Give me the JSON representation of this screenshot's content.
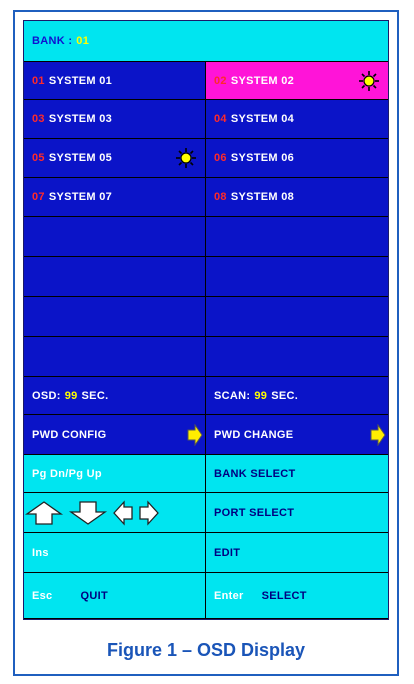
{
  "bank": {
    "label": "BANK :",
    "value": "01"
  },
  "systems": [
    {
      "num": "01",
      "name": "SYSTEM 01",
      "selected": false,
      "active": false
    },
    {
      "num": "02",
      "name": "SYSTEM 02",
      "selected": true,
      "active": true
    },
    {
      "num": "03",
      "name": "SYSTEM 03",
      "selected": false,
      "active": false
    },
    {
      "num": "04",
      "name": "SYSTEM 04",
      "selected": false,
      "active": false
    },
    {
      "num": "05",
      "name": "SYSTEM 05",
      "selected": false,
      "active": true
    },
    {
      "num": "06",
      "name": "SYSTEM 06",
      "selected": false,
      "active": false
    },
    {
      "num": "07",
      "name": "SYSTEM 07",
      "selected": false,
      "active": false
    },
    {
      "num": "08",
      "name": "SYSTEM 08",
      "selected": false,
      "active": false
    }
  ],
  "timers": {
    "osd_label": "OSD:",
    "osd_value": "99",
    "osd_unit": "SEC.",
    "scan_label": "SCAN:",
    "scan_value": "99",
    "scan_unit": "SEC."
  },
  "password": {
    "config": "PWD CONFIG",
    "change": "PWD CHANGE"
  },
  "help": {
    "pg_keys": "Pg Dn/Pg Up",
    "bank_select": "BANK SELECT",
    "port_select": "PORT SELECT",
    "ins": "Ins",
    "edit": "EDIT",
    "esc": "Esc",
    "quit": "QUIT",
    "enter": "Enter",
    "select": "SELECT"
  },
  "caption": "Figure 1 – OSD Display",
  "colors": {
    "panel_blue": "#0b14c8",
    "help_cyan": "#00e5f0",
    "selected_magenta": "#ff14d8",
    "number_red": "#ff2a2a",
    "value_yellow": "#ffff00",
    "caption_blue": "#1a55b8"
  },
  "icons": {
    "active": "sun-icon",
    "next": "arrow-right-icon"
  }
}
